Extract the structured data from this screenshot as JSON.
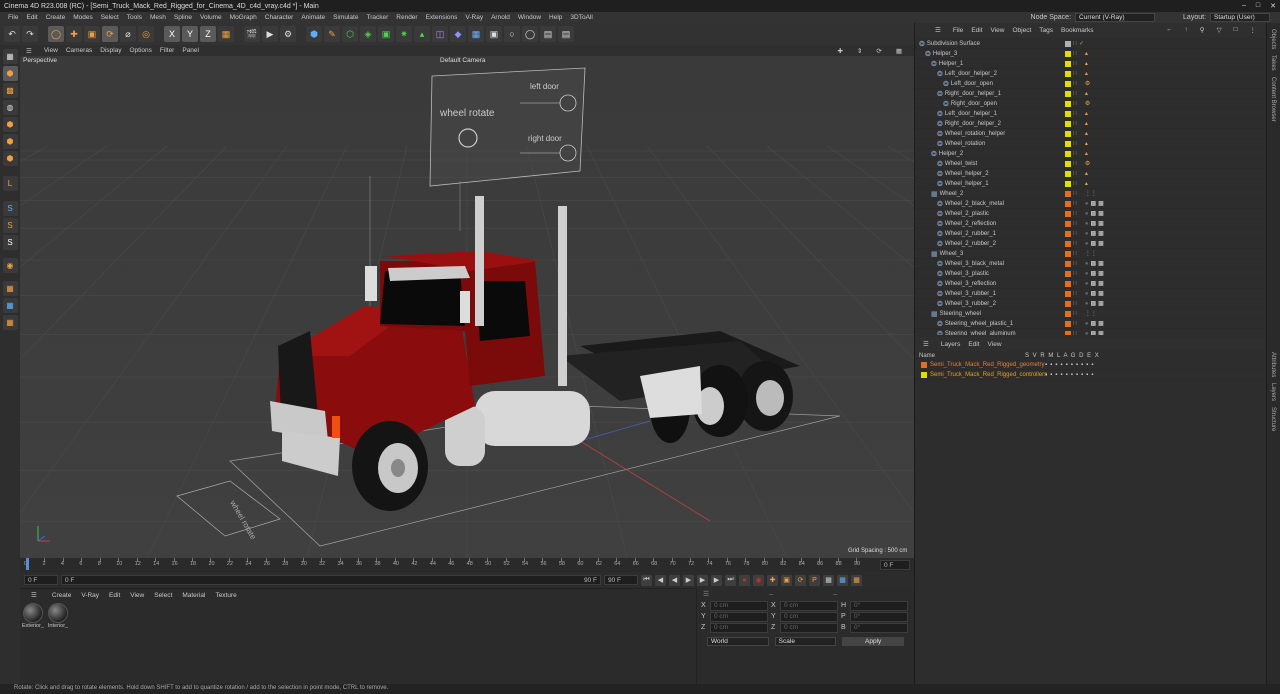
{
  "app": {
    "title": "Cinema 4D R23.008 (RC) - [Semi_Truck_Mack_Red_Rigged_for_Cinema_4D_c4d_vray.c4d *] - Main"
  },
  "menu": [
    "File",
    "Edit",
    "Create",
    "Modes",
    "Select",
    "Tools",
    "Mesh",
    "Spline",
    "Volume",
    "MoGraph",
    "Character",
    "Animate",
    "Simulate",
    "Tracker",
    "Render",
    "Extensions",
    "V-Ray",
    "Arnold",
    "Window",
    "Help",
    "3DToAll"
  ],
  "node_space": {
    "label": "Node Space:",
    "value": "Current (V-Ray)"
  },
  "layout": {
    "label": "Layout:",
    "value": "Startup (User)"
  },
  "viewport": {
    "menu": [
      "View",
      "Cameras",
      "Display",
      "Options",
      "Filter",
      "Panel"
    ],
    "name": "Perspective",
    "camera": "Default Camera",
    "grid_spacing": "Grid Spacing : 500 cm",
    "billboard": {
      "wheel_rotate": "wheel rotate",
      "left_door": "left door",
      "right_door": "right door"
    },
    "ground_label": "wheel rotate"
  },
  "timeline": {
    "ticks": [
      "0",
      "2",
      "4",
      "6",
      "8",
      "10",
      "12",
      "14",
      "16",
      "18",
      "20",
      "22",
      "24",
      "26",
      "28",
      "30",
      "32",
      "34",
      "36",
      "38",
      "40",
      "42",
      "44",
      "46",
      "48",
      "50",
      "52",
      "54",
      "56",
      "58",
      "60",
      "62",
      "64",
      "66",
      "68",
      "70",
      "72",
      "74",
      "76",
      "78",
      "80",
      "82",
      "84",
      "86",
      "88",
      "90"
    ],
    "current": "0 F"
  },
  "transport": {
    "start": "0 F",
    "range_start": "0 F",
    "range_end": "90 F",
    "end": "90 F"
  },
  "material_panel": {
    "menu": [
      "Create",
      "V-Ray",
      "Edit",
      "View",
      "Select",
      "Material",
      "Texture"
    ],
    "materials": [
      {
        "name": "Exterior_"
      },
      {
        "name": "Interior_"
      }
    ]
  },
  "coordinates": {
    "rows": [
      {
        "a": "X",
        "av": "0 cm",
        "b": "X",
        "bv": "0 cm",
        "c": "H",
        "cv": "0°"
      },
      {
        "a": "Y",
        "av": "0 cm",
        "b": "Y",
        "bv": "0 cm",
        "c": "P",
        "cv": "0°"
      },
      {
        "a": "Z",
        "av": "0 cm",
        "b": "Z",
        "bv": "0 cm",
        "c": "B",
        "cv": "0°"
      }
    ],
    "mode1": "World",
    "mode2": "Scale",
    "apply": "Apply"
  },
  "object_manager": {
    "menu": [
      "File",
      "Edit",
      "View",
      "Object",
      "Tags",
      "Bookmarks"
    ],
    "items": [
      {
        "name": "Subdivision Surface",
        "depth": 0,
        "color": "#b0b0b0",
        "tag": "check"
      },
      {
        "name": "Helper_3",
        "depth": 1,
        "color": "#e0e000",
        "tag": "null"
      },
      {
        "name": "Helper_1",
        "depth": 2,
        "color": "#e0e000",
        "tag": "null"
      },
      {
        "name": "Left_door_helper_2",
        "depth": 3,
        "color": "#e0e000",
        "tag": "null"
      },
      {
        "name": "Left_door_open",
        "depth": 4,
        "color": "#e0e000",
        "tag": "xp"
      },
      {
        "name": "Right_door_helper_1",
        "depth": 3,
        "color": "#e0e000",
        "tag": "null"
      },
      {
        "name": "Right_door_open",
        "depth": 4,
        "color": "#e0e000",
        "tag": "xp"
      },
      {
        "name": "Left_door_helper_1",
        "depth": 3,
        "color": "#e0e000",
        "tag": "null"
      },
      {
        "name": "Right_door_helper_2",
        "depth": 3,
        "color": "#e0e000",
        "tag": "null"
      },
      {
        "name": "Wheel_rotation_helper",
        "depth": 3,
        "color": "#e0e000",
        "tag": "null"
      },
      {
        "name": "Wheel_rotation",
        "depth": 3,
        "color": "#e0e000",
        "tag": "null"
      },
      {
        "name": "Helper_2",
        "depth": 2,
        "color": "#e0e000",
        "tag": "null"
      },
      {
        "name": "Wheel_twist",
        "depth": 3,
        "color": "#e0e000",
        "tag": "xp"
      },
      {
        "name": "Wheel_helper_2",
        "depth": 3,
        "color": "#e0e000",
        "tag": "null"
      },
      {
        "name": "Wheel_helper_1",
        "depth": 3,
        "color": "#e0e000",
        "tag": "null"
      },
      {
        "name": "Wheel_2",
        "depth": 2,
        "color": "#e07020",
        "tag": "grp"
      },
      {
        "name": "Wheel_2_black_metal",
        "depth": 3,
        "color": "#e07020",
        "tag": "mat"
      },
      {
        "name": "Wheel_2_plastic",
        "depth": 3,
        "color": "#e07020",
        "tag": "mat"
      },
      {
        "name": "Wheel_2_reflection",
        "depth": 3,
        "color": "#e07020",
        "tag": "mat"
      },
      {
        "name": "Wheel_2_rubber_1",
        "depth": 3,
        "color": "#e07020",
        "tag": "mat"
      },
      {
        "name": "Wheel_2_rubber_2",
        "depth": 3,
        "color": "#e07020",
        "tag": "mat"
      },
      {
        "name": "Wheel_3",
        "depth": 2,
        "color": "#e07020",
        "tag": "grp"
      },
      {
        "name": "Wheel_3_black_metal",
        "depth": 3,
        "color": "#e07020",
        "tag": "mat"
      },
      {
        "name": "Wheel_3_plastic",
        "depth": 3,
        "color": "#e07020",
        "tag": "mat"
      },
      {
        "name": "Wheel_3_reflection",
        "depth": 3,
        "color": "#e07020",
        "tag": "mat"
      },
      {
        "name": "Wheel_3_rubber_1",
        "depth": 3,
        "color": "#e07020",
        "tag": "mat"
      },
      {
        "name": "Wheel_3_rubber_2",
        "depth": 3,
        "color": "#e07020",
        "tag": "mat"
      },
      {
        "name": "Steering_wheel",
        "depth": 2,
        "color": "#e07020",
        "tag": "grp"
      },
      {
        "name": "Steering_wheel_plastic_1",
        "depth": 3,
        "color": "#e07020",
        "tag": "mat"
      },
      {
        "name": "Steering_wheel_aluminum",
        "depth": 3,
        "color": "#e07020",
        "tag": "mat"
      }
    ]
  },
  "layers": {
    "menu": [
      "Layers",
      "Edit",
      "View"
    ],
    "header": {
      "name": "Name",
      "flags": "S V R M L A G D E X"
    },
    "items": [
      {
        "name": "Semi_Truck_Mack_Red_Rigged_geometry",
        "color": "#e07020"
      },
      {
        "name": "Semi_Truck_Mack_Red_Rigged_controllers",
        "color": "#e0e000"
      }
    ]
  },
  "side_tabs": [
    "Objects",
    "Takes",
    "Content Browser",
    "Attributes",
    "Layers",
    "Structure"
  ],
  "status": "Rotate: Click and drag to rotate elements. Hold down SHIFT to add to quantize rotation / add to the selection in point mode, CTRL to remove."
}
